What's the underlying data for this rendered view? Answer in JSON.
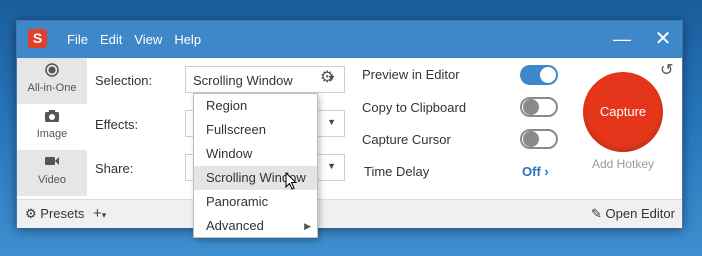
{
  "app": {
    "logo_letter": "S",
    "menu": [
      "File",
      "Edit",
      "View",
      "Help"
    ]
  },
  "window_controls": {
    "minimize": "—",
    "close": "✕"
  },
  "sidebar": {
    "items": [
      {
        "label": "All-in-One",
        "icon": "record-icon"
      },
      {
        "label": "Image",
        "icon": "camera-icon"
      },
      {
        "label": "Video",
        "icon": "video-camera-icon"
      }
    ]
  },
  "form": {
    "selection_label": "Selection:",
    "selection_value": "Scrolling Window",
    "effects_label": "Effects:",
    "share_label": "Share:"
  },
  "selection_menu": {
    "items": [
      "Region",
      "Fullscreen",
      "Window",
      "Scrolling Window",
      "Panoramic",
      "Advanced"
    ],
    "hovered": "Scrolling Window"
  },
  "options": {
    "preview_label": "Preview in Editor",
    "preview_on": true,
    "clipboard_label": "Copy to Clipboard",
    "clipboard_on": false,
    "cursor_label": "Capture Cursor",
    "cursor_on": false,
    "delay_label": "Time Delay",
    "delay_value": "Off"
  },
  "capture": {
    "label": "Capture",
    "hotkey_label": "Add Hotkey"
  },
  "footer": {
    "presets_label": "Presets",
    "add_label": "+",
    "open_editor_label": "Open Editor"
  },
  "colors": {
    "accent": "#3e87c9",
    "capture": "#e5361b",
    "logo": "#e2402a"
  }
}
